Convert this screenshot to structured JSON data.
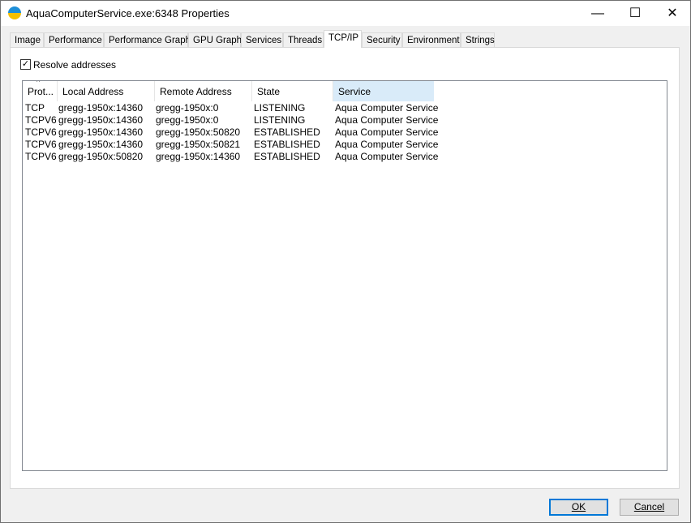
{
  "window": {
    "title": "AquaComputerService.exe:6348 Properties",
    "minimize": "—",
    "maximize": "☐",
    "close": "✕"
  },
  "tabs": [
    "Image",
    "Performance",
    "Performance Graph",
    "GPU Graph",
    "Services",
    "Threads",
    "TCP/IP",
    "Security",
    "Environment",
    "Strings"
  ],
  "active_tab": "TCP/IP",
  "resolve": {
    "label": "Resolve addresses",
    "checked": true,
    "check": "✓"
  },
  "columns": [
    "Prot...",
    "Local Address",
    "Remote Address",
    "State",
    "Service"
  ],
  "sort_indicator": "^",
  "rows": [
    [
      "TCP",
      "gregg-1950x:14360",
      "gregg-1950x:0",
      "LISTENING",
      "Aqua Computer Service"
    ],
    [
      "TCPV6",
      "gregg-1950x:14360",
      "gregg-1950x:0",
      "LISTENING",
      "Aqua Computer Service"
    ],
    [
      "TCPV6",
      "gregg-1950x:14360",
      "gregg-1950x:50820",
      "ESTABLISHED",
      "Aqua Computer Service"
    ],
    [
      "TCPV6",
      "gregg-1950x:14360",
      "gregg-1950x:50821",
      "ESTABLISHED",
      "Aqua Computer Service"
    ],
    [
      "TCPV6",
      "gregg-1950x:50820",
      "gregg-1950x:14360",
      "ESTABLISHED",
      "Aqua Computer Service"
    ]
  ],
  "buttons": {
    "ok": "OK",
    "cancel": "Cancel"
  }
}
